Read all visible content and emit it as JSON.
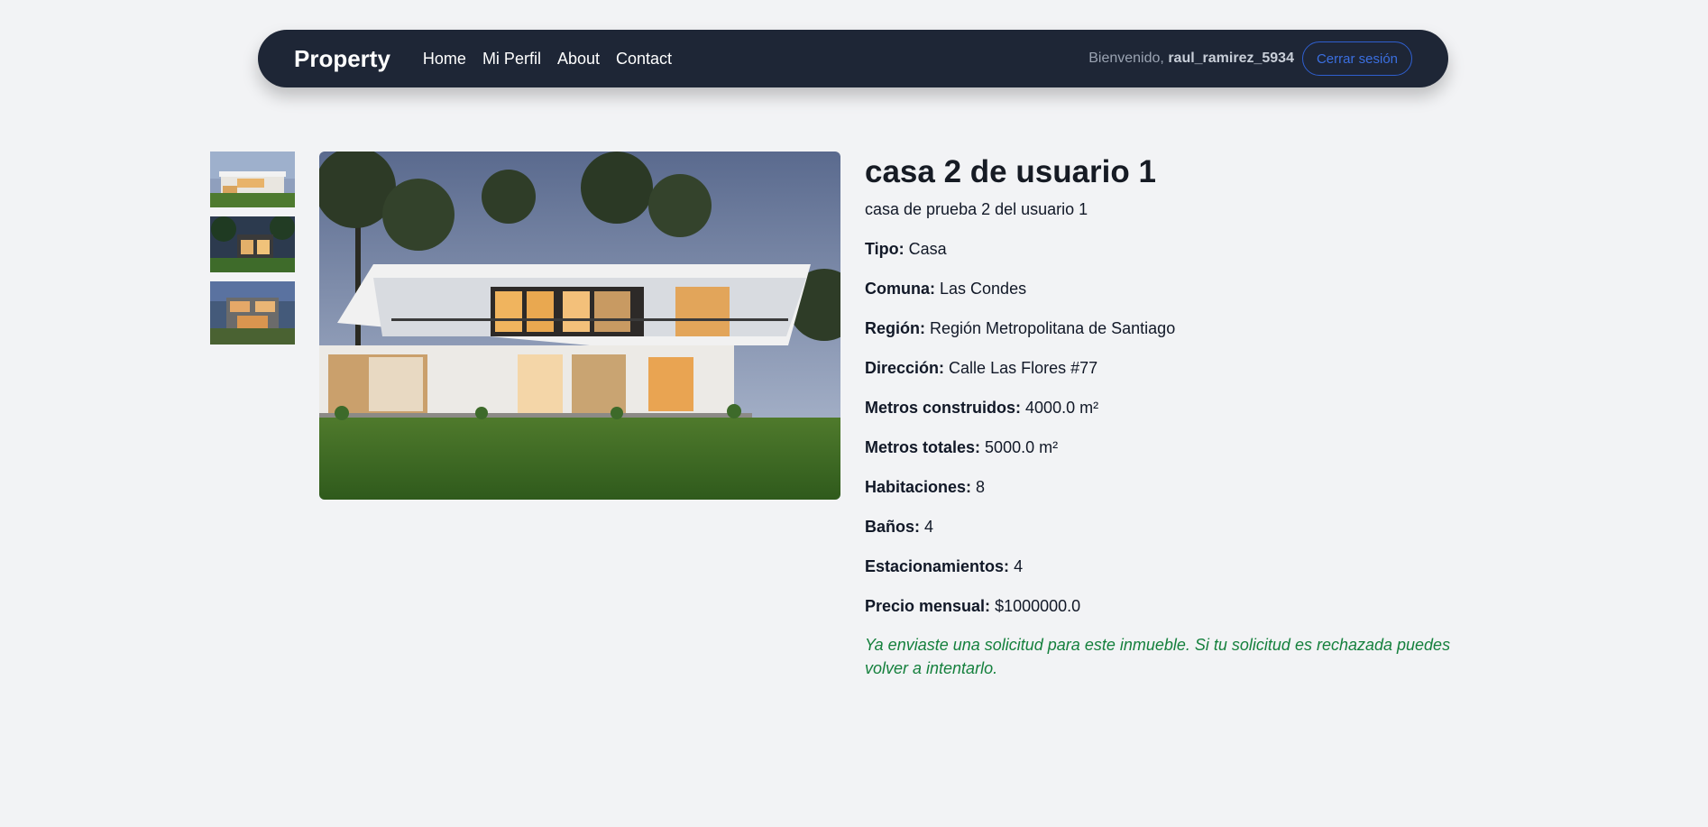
{
  "navbar": {
    "brand": "Property",
    "links": [
      "Home",
      "Mi Perfil",
      "About",
      "Contact"
    ],
    "welcome_prefix": "Bienvenido,",
    "username": "raul_ramirez_5934",
    "logout_label": "Cerrar sesión"
  },
  "property": {
    "title": "casa 2 de usuario 1",
    "description": "casa de prueba 2 del usuario 1",
    "fields": [
      {
        "label": "Tipo:",
        "value": "Casa"
      },
      {
        "label": "Comuna:",
        "value": "Las Condes"
      },
      {
        "label": "Región:",
        "value": "Región Metropolitana de Santiago"
      },
      {
        "label": "Dirección:",
        "value": "Calle Las Flores #77"
      },
      {
        "label": "Metros construidos:",
        "value": "4000.0 m²"
      },
      {
        "label": "Metros totales:",
        "value": "5000.0 m²"
      },
      {
        "label": "Habitaciones:",
        "value": "8"
      },
      {
        "label": "Baños:",
        "value": "4"
      },
      {
        "label": "Estacionamientos:",
        "value": "4"
      },
      {
        "label": "Precio mensual:",
        "value": "$1000000.0"
      }
    ],
    "notice": "Ya enviaste una solicitud para este inmueble. Si tu solicitud es rechazada puedes volver a intentarlo."
  },
  "colors": {
    "navbar_bg": "#1e2636",
    "page_bg": "#f2f3f5",
    "accent": "#3b6fe0",
    "notice": "#15803d"
  }
}
